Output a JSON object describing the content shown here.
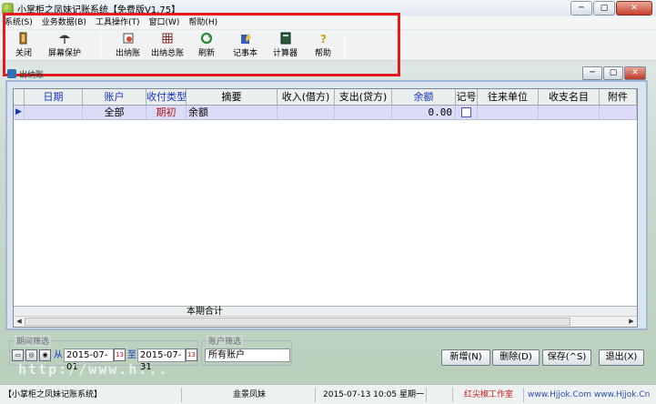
{
  "window": {
    "title": "小掌柜之凤妹记账系统【免费版V1.75】"
  },
  "menu": [
    "系统(S)",
    "业务数据(B)",
    "工具操作(T)",
    "窗口(W)",
    "帮助(H)"
  ],
  "toolbar": [
    {
      "label": "关闭",
      "icon": "close-door-icon"
    },
    {
      "label": "屏幕保护",
      "icon": "umbrella-icon"
    },
    {
      "label": "出纳账",
      "icon": "ledger-icon"
    },
    {
      "label": "出纳总账",
      "icon": "grid-ledger-icon"
    },
    {
      "label": "刷新",
      "icon": "refresh-icon"
    },
    {
      "label": "记事本",
      "icon": "notepad-icon"
    },
    {
      "label": "计算器",
      "icon": "calculator-icon"
    },
    {
      "label": "帮助",
      "icon": "help-icon"
    }
  ],
  "child": {
    "title": "出纳账"
  },
  "grid": {
    "columns": [
      "日期",
      "账户",
      "收付类型",
      "摘要",
      "收入(借方)",
      "支出(贷方)",
      "余额",
      "记号",
      "往来单位",
      "收支名目",
      "附件"
    ],
    "row": {
      "marker": "▶",
      "date": "",
      "account": "全部",
      "type": "期初",
      "summary": "余额",
      "income": "",
      "expense": "",
      "balance": "0.00",
      "mark": "",
      "partner": "",
      "category": "",
      "attachment": ""
    },
    "footer": {
      "label": "本期合计"
    }
  },
  "filters": {
    "period_label": "期间筛选",
    "from_label": "从",
    "to_label": "至",
    "date_from": "2015-07-01",
    "date_to": "2015-07-31",
    "account_label": "账户筛选",
    "account_value": "所有账户"
  },
  "actions": [
    "新增(N)",
    "删除(D)",
    "保存(^S)",
    "退出(X)"
  ],
  "watermark": "http://www.h...",
  "status": [
    "【小掌柜之凤妹记账系统】",
    "韭景凤妹",
    "2015-07-13 10:05 星期一",
    "红尖椒工作室",
    "www.Hjjok.Com www.Hjjok.Cn"
  ],
  "colors": {
    "highlight": "#e8181c",
    "grid_row": "#dcdcf6",
    "header_blue": "#1434c8"
  }
}
